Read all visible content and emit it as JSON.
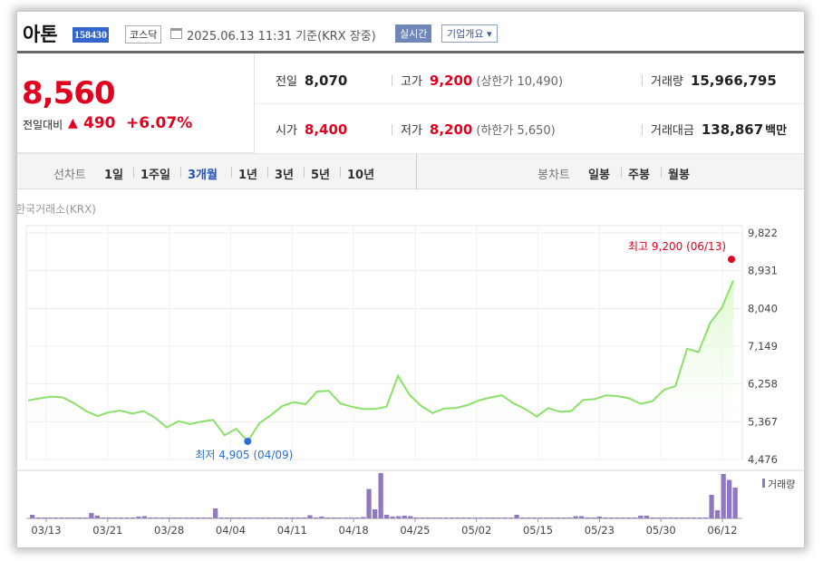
{
  "header": {
    "stock_name": "아톤",
    "stock_code": "158430",
    "market": "코스닥",
    "datetime": "2025.06.13 11:31 기준(KRX 장중)",
    "realtime_label": "실시간",
    "company_info_label": "기업개요 ▾"
  },
  "price": {
    "current": "8,560",
    "change_label": "전일대비",
    "change_arrow": "▲",
    "change": "490",
    "change_pct": "+6.07%",
    "color_up": "#e1001e"
  },
  "stats": {
    "prev_label": "전일",
    "prev": "8,070",
    "high_label": "고가",
    "high": "9,200",
    "upper_limit": "(상한가 10,490)",
    "volume_label": "거래량",
    "volume": "15,966,795",
    "open_label": "시가",
    "open": "8,400",
    "low_label": "저가",
    "low": "8,200",
    "lower_limit": "(하한가 5,650)",
    "value_label": "거래대금",
    "value": "138,867",
    "value_unit": "백만"
  },
  "tabs": {
    "line_chart_label": "선차트",
    "periods": [
      "1일",
      "1주일",
      "3개월",
      "1년",
      "3년",
      "5년",
      "10년"
    ],
    "active_period": "3개월",
    "candle_chart_label": "봉차트",
    "candles": [
      "일봉",
      "주봉",
      "월봉"
    ]
  },
  "chart_source": "한국거래소(KRX)",
  "chart_data": {
    "type": "line",
    "y_ticks": [
      "9,822",
      "8,931",
      "8,040",
      "7,149",
      "6,258",
      "5,367",
      "4,476"
    ],
    "ylim": [
      4476,
      9822
    ],
    "x_tick_labels": [
      "03/13",
      "03/21",
      "03/28",
      "04/04",
      "04/11",
      "04/18",
      "04/25",
      "05/02",
      "05/15",
      "05/23",
      "05/30",
      "06/12"
    ],
    "max_annotation": "최고 9,200 (06/13)",
    "min_annotation": "최저 4,905 (04/09)",
    "max_point": {
      "date": "06/13",
      "value": 9200
    },
    "min_point": {
      "date": "04/09",
      "value": 4905
    },
    "price_series": [
      5870,
      5920,
      5960,
      5940,
      5800,
      5620,
      5500,
      5590,
      5630,
      5560,
      5620,
      5460,
      5230,
      5380,
      5310,
      5370,
      5410,
      5050,
      5200,
      4905,
      5330,
      5520,
      5740,
      5830,
      5780,
      6080,
      6100,
      5800,
      5720,
      5670,
      5670,
      5720,
      6450,
      6000,
      5740,
      5570,
      5680,
      5690,
      5760,
      5870,
      5940,
      5990,
      5800,
      5670,
      5490,
      5690,
      5600,
      5620,
      5880,
      5900,
      5990,
      5970,
      5920,
      5790,
      5850,
      6120,
      6210,
      7090,
      7010,
      7700,
      8050,
      8700
    ],
    "volume_label": "거래량",
    "volume_series": [
      0.08,
      0.02,
      0.02,
      0.02,
      0.02,
      0.02,
      0.02,
      0.02,
      0.02,
      0.02,
      0.12,
      0.06,
      0.02,
      0.02,
      0.02,
      0.02,
      0.02,
      0.02,
      0.04,
      0.05,
      0.02,
      0.02,
      0.02,
      0.02,
      0.02,
      0.02,
      0.02,
      0.02,
      0.02,
      0.02,
      0.02,
      0.22,
      0.02,
      0.02,
      0.02,
      0.02,
      0.02,
      0.02,
      0.02,
      0.02,
      0.02,
      0.02,
      0.02,
      0.02,
      0.02,
      0.02,
      0.02,
      0.07,
      0.02,
      0.04,
      0.02,
      0.02,
      0.02,
      0.02,
      0.02,
      0.02,
      0.03,
      0.65,
      0.2,
      1.0,
      0.08,
      0.04,
      0.05,
      0.06,
      0.05,
      0.02,
      0.02,
      0.02,
      0.02,
      0.02,
      0.02,
      0.02,
      0.02,
      0.02,
      0.02,
      0.02,
      0.02,
      0.02,
      0.02,
      0.02,
      0.02,
      0.02,
      0.08,
      0.02,
      0.02,
      0.02,
      0.02,
      0.02,
      0.02,
      0.02,
      0.02,
      0.02,
      0.05,
      0.05,
      0.02,
      0.02,
      0.04,
      0.02,
      0.02,
      0.02,
      0.02,
      0.02,
      0.02,
      0.06,
      0.06,
      0.02,
      0.02,
      0.02,
      0.02,
      0.02,
      0.02,
      0.02,
      0.02,
      0.02,
      0.02,
      0.52,
      0.18,
      0.98,
      0.85,
      0.68
    ],
    "line_color": "#8be06a",
    "fill_color": "#d9f7c8",
    "volume_color": "#9079c2"
  }
}
